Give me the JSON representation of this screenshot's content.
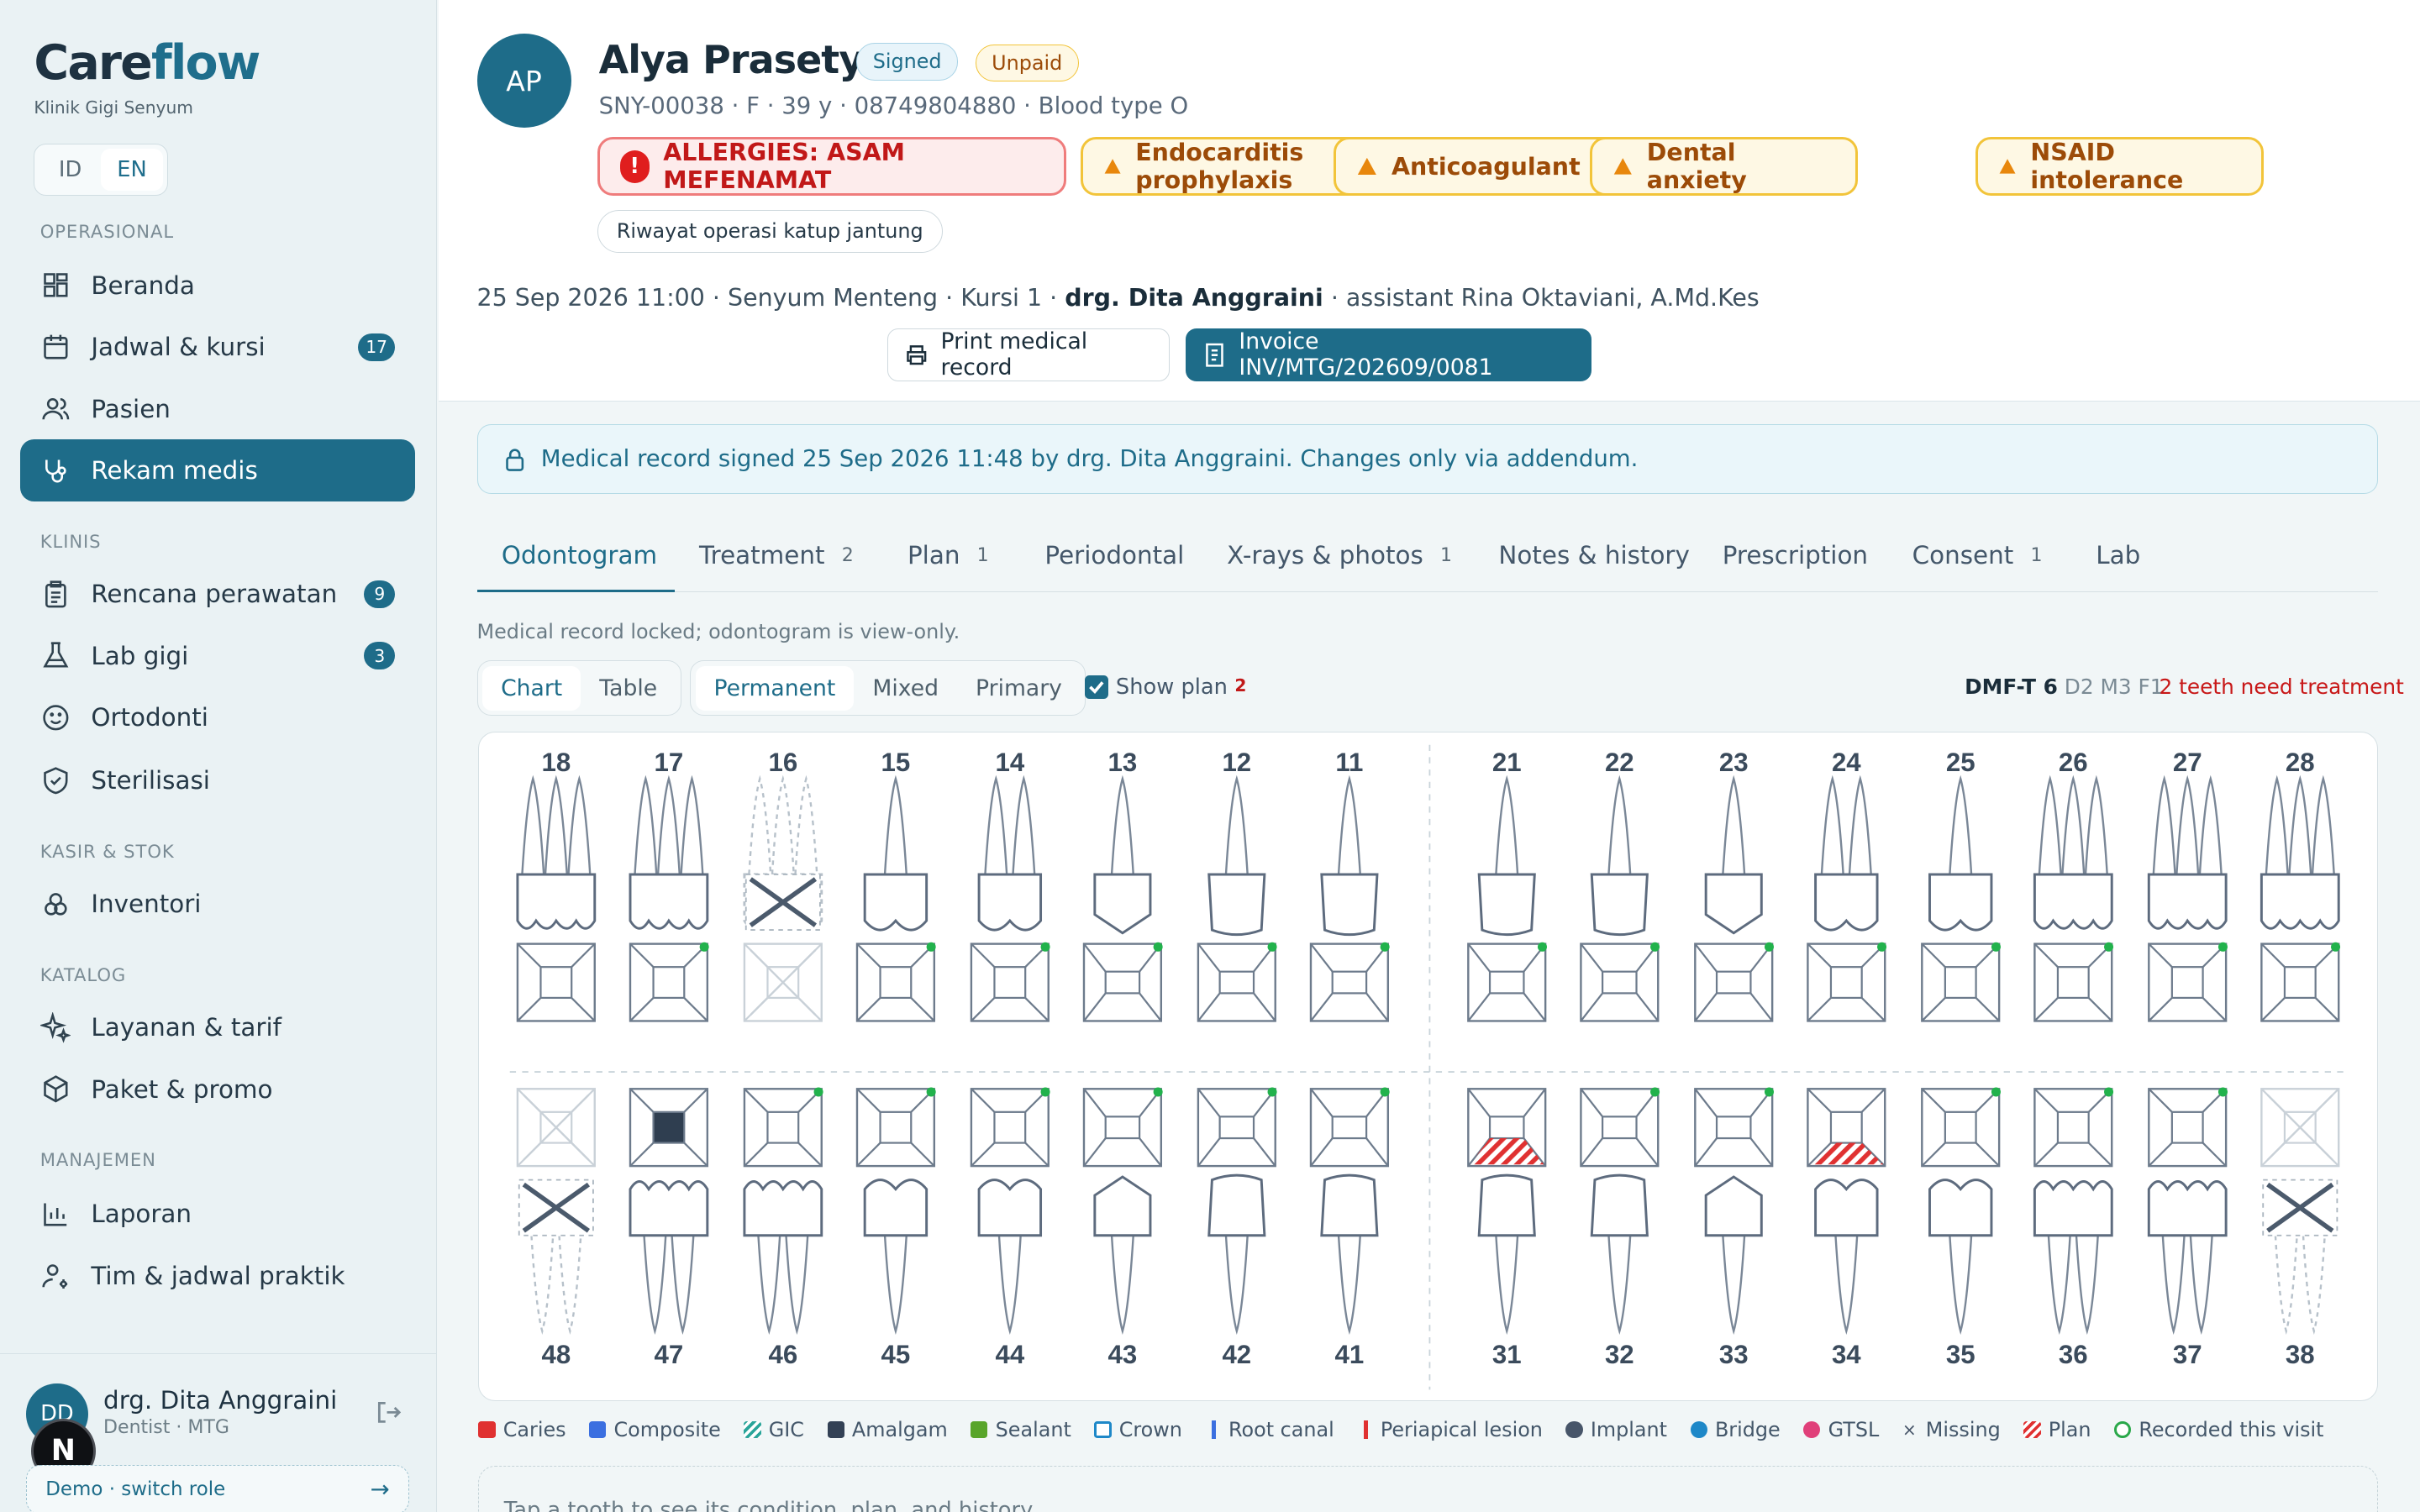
{
  "app": {
    "name_a": "Care",
    "name_b": "flow",
    "clinic": "Klinik Gigi Senyum",
    "lang": [
      "ID",
      "EN"
    ]
  },
  "nav": {
    "s1": "OPERASIONAL",
    "s2": "KLINIS",
    "s3": "KASIR & STOK",
    "s4": "KATALOG",
    "s5": "MANAJEMEN",
    "items": [
      {
        "label": "Beranda",
        "icon": "grid-icon"
      },
      {
        "label": "Jadwal & kursi",
        "icon": "calendar-icon",
        "count": "17"
      },
      {
        "label": "Pasien",
        "icon": "users-icon"
      },
      {
        "label": "Rekam medis",
        "icon": "stethoscope-icon",
        "active": true
      },
      {
        "label": "Rencana perawatan",
        "icon": "clipboard-icon",
        "count": "9"
      },
      {
        "label": "Lab gigi",
        "icon": "flask-icon",
        "count": "3"
      },
      {
        "label": "Ortodonti",
        "icon": "smile-icon"
      },
      {
        "label": "Sterilisasi",
        "icon": "shield-icon"
      },
      {
        "label": "Inventori",
        "icon": "boxes-icon"
      },
      {
        "label": "Layanan & tarif",
        "icon": "sparkle-icon"
      },
      {
        "label": "Paket & promo",
        "icon": "package-icon"
      },
      {
        "label": "Laporan",
        "icon": "bar-chart-icon"
      },
      {
        "label": "Tim & jadwal praktik",
        "icon": "user-gear-icon"
      }
    ]
  },
  "user": {
    "initials": "DD",
    "name": "drg. Dita Anggraini",
    "role": "Dentist · MTG",
    "demo": "Demo · switch role",
    "badge": "N"
  },
  "patient": {
    "initials": "AP",
    "name": "Alya Prasetyo",
    "status1": "Signed",
    "status2": "Unpaid",
    "meta": "SNY-00038 · F · 39 y · 08749804880 · Blood type O",
    "allergy": "ALLERGIES: ASAM MEFENAMAT",
    "alerts": [
      "Endocarditis prophylaxis",
      "Anticoagulant",
      "Dental anxiety",
      "NSAID intolerance"
    ],
    "history": "Riwayat operasi katup jantung",
    "appt_a": "25 Sep 2026 11:00 · Senyum Menteng · Kursi 1 · ",
    "appt_doc": "drg. Dita Anggraini",
    "appt_b": " · assistant Rina Oktaviani, A.Md.Kes",
    "print": "Print medical record",
    "invoice": "Invoice INV/MTG/202609/0081"
  },
  "lock": "Medical record signed 25 Sep 2026 11:48 by drg. Dita Anggraini. Changes only via addendum.",
  "tabs": [
    {
      "label": "Odontogram",
      "n": ""
    },
    {
      "label": "Treatment",
      "n": "2"
    },
    {
      "label": "Plan",
      "n": "1"
    },
    {
      "label": "Periodontal",
      "n": ""
    },
    {
      "label": "X-rays & photos",
      "n": "1"
    },
    {
      "label": "Notes & history",
      "n": ""
    },
    {
      "label": "Prescription",
      "n": ""
    },
    {
      "label": "Consent",
      "n": "1"
    },
    {
      "label": "Lab",
      "n": ""
    }
  ],
  "odonto": {
    "note": "Medical record locked; odontogram is view-only.",
    "view": [
      "Chart",
      "Table"
    ],
    "dent": [
      "Permanent",
      "Mixed",
      "Primary"
    ],
    "show_plan": "Show plan",
    "plan_count": "2",
    "dmft_label": "DMF-T 6",
    "dmft_detail": " D2 M3 F1",
    "need": "2 teeth need treatment",
    "upper": [
      "18",
      "17",
      "16",
      "15",
      "14",
      "13",
      "12",
      "11",
      "21",
      "22",
      "23",
      "24",
      "25",
      "26",
      "27",
      "28"
    ],
    "lower": [
      "48",
      "47",
      "46",
      "45",
      "44",
      "43",
      "42",
      "41",
      "31",
      "32",
      "33",
      "34",
      "35",
      "36",
      "37",
      "38"
    ],
    "hint": "Tap a tooth to see its condition, plan, and history."
  },
  "legend": [
    {
      "label": "Caries",
      "color": "#e03131"
    },
    {
      "label": "Composite",
      "color": "#3b6fe0"
    },
    {
      "label": "GIC",
      "color": "#2aa59a"
    },
    {
      "label": "Amalgam",
      "color": "#334155"
    },
    {
      "label": "Sealant",
      "color": "#58a52a"
    },
    {
      "label": "Crown",
      "color": "#1e88c8"
    },
    {
      "label": "Root canal",
      "color": "#3b6fe0"
    },
    {
      "label": "Periapical lesion",
      "color": "#e03131"
    },
    {
      "label": "Implant",
      "color": "#475569"
    },
    {
      "label": "Bridge",
      "color": "#1e88c8"
    },
    {
      "label": "GTSL",
      "color": "#e0407a"
    },
    {
      "label": "Missing",
      "color": "#475569"
    },
    {
      "label": "Plan",
      "color": "#e03131"
    },
    {
      "label": "Recorded this visit",
      "color": "#2aa84a"
    }
  ]
}
